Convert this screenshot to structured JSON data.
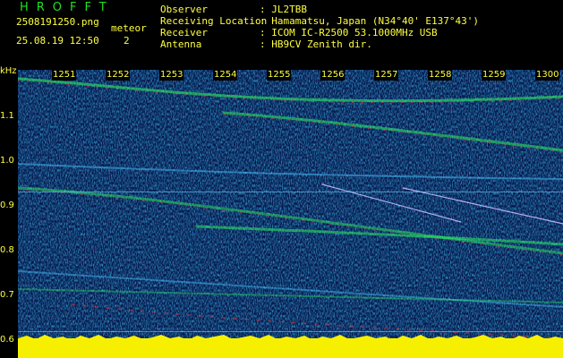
{
  "header": {
    "logo": "HROFFT",
    "filename": "2508191250.png",
    "meteor_label": "meteor",
    "meteor_count": "2",
    "datetime": "25.08.19 12:50",
    "fields": [
      {
        "label": "Observer",
        "value": ": JL2TBB"
      },
      {
        "label": "Receiving Location",
        "value": ": Hamamatsu, Japan (N34°40' E137°43')"
      },
      {
        "label": "Receiver",
        "value": ": ICOM IC-R2500 53.1000MHz USB"
      },
      {
        "label": "Antenna",
        "value": ": HB9CV Zenith dir."
      }
    ]
  },
  "yaxis": {
    "unit": "kHz",
    "ticks": [
      "1.1",
      "1.0",
      "0.9",
      "0.8",
      "0.7",
      "0.6"
    ]
  },
  "xaxis": {
    "ticks": [
      "1251",
      "1252",
      "1253",
      "1254",
      "1255",
      "1256",
      "1257",
      "1258",
      "1259",
      "1300"
    ]
  },
  "colors": {
    "background": "#06154a",
    "signal_strong": "#ff3020",
    "signal_mid": "#30ff60",
    "noise_floor": "#f6f000",
    "label_text": "#ffff40",
    "logo": "#20e020"
  }
}
